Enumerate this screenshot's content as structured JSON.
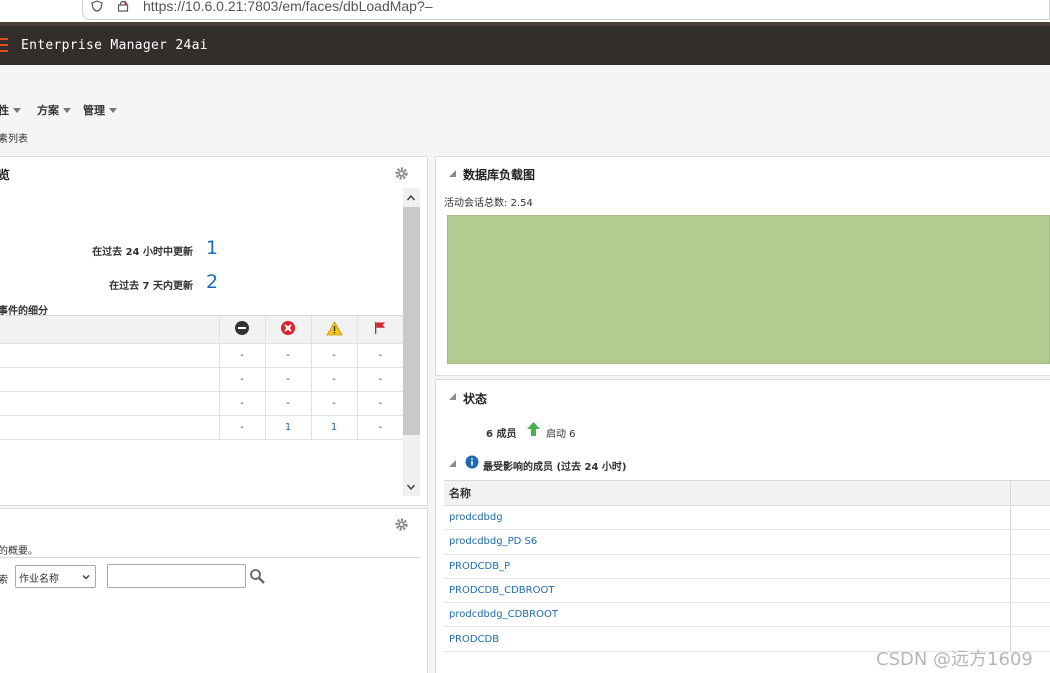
{
  "browser": {
    "url": "https://10.6.0.21:7803/em/faces/dbLoadMap?–"
  },
  "app": {
    "title": "Enterprise Manager 24ai"
  },
  "menu": {
    "items": [
      {
        "label": "性"
      },
      {
        "label": "方案"
      },
      {
        "label": "管理"
      }
    ],
    "breadcrumb": "素列表"
  },
  "overview_panel": {
    "title": "览",
    "updated_24h_label": "在过去 24 小时中更新",
    "updated_24h_value": "1",
    "updated_7d_label": "在过去 7 天内更新",
    "updated_7d_value": "2",
    "breakdown_title": "事件的细分",
    "columns": [
      "fatal-icon",
      "critical-icon",
      "warning-icon",
      "escalated-flag-icon"
    ],
    "rows": [
      [
        "-",
        "-",
        "-",
        "-"
      ],
      [
        "-",
        "-",
        "-",
        "-"
      ],
      [
        "-",
        "-",
        "-",
        "-"
      ],
      [
        "-",
        "1",
        "1",
        "-"
      ]
    ]
  },
  "jobs_panel": {
    "summary_text": "的概要。",
    "search_label": "索",
    "select_value": "作业名称",
    "input_value": ""
  },
  "load_map_panel": {
    "title": "数据库负载图",
    "active_sessions_label": "活动会话总数: 2.54",
    "chart_color": "#b2cb91"
  },
  "status_panel": {
    "title": "状态",
    "members_label": "6 成员",
    "up_label": "启动 6",
    "affected_title": "最受影响的成员 (过去 24 小时)",
    "table_header": "名称",
    "members": [
      "prodcdbdg",
      "prodcdbdg_PD    S6",
      "PRODCDB_P",
      "PRODCDB_CDBROOT",
      "prodcdbdg_CDBROOT",
      "PRODCDB"
    ]
  },
  "watermark": "CSDN @远方1609",
  "colors": {
    "header_bg": "#332e2b",
    "link": "#1f6bae",
    "up_arrow": "#4caf50"
  }
}
